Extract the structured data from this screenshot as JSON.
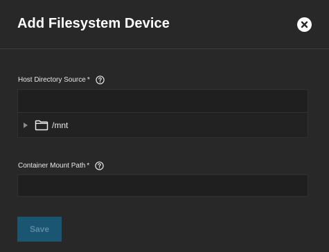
{
  "dialog": {
    "title": "Add Filesystem Device"
  },
  "host_directory": {
    "label": "Host Directory Source",
    "required_mark": "*",
    "value": "",
    "placeholder": "",
    "tree": [
      {
        "label": "/mnt",
        "expanded": false
      }
    ]
  },
  "container_mount": {
    "label": "Container Mount Path",
    "required_mark": "*",
    "value": "",
    "placeholder": ""
  },
  "actions": {
    "save_label": "Save",
    "save_enabled": false
  },
  "icons": {
    "close": "close-icon",
    "help": "help-icon",
    "folder": "folder-icon",
    "expander": "chevron-right-icon"
  },
  "colors": {
    "background": "#282828",
    "input_background": "#1f1f1f",
    "save_button_disabled": "#1a5572",
    "text": "#e6e6e6"
  }
}
